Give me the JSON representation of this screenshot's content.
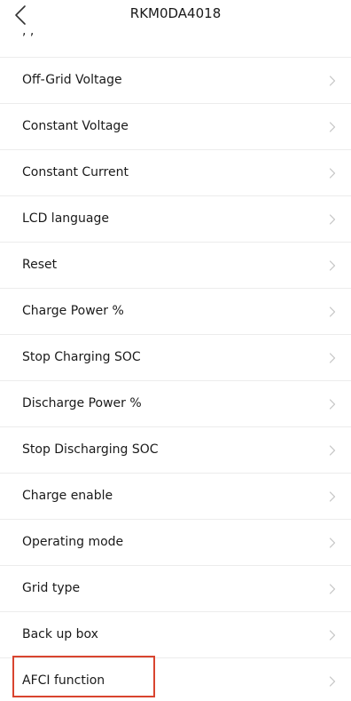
{
  "header": {
    "title": "RKM0DA4018",
    "back_icon": "chevron-left-icon"
  },
  "partial_row_text": ", ,",
  "settings": [
    {
      "label": "Off-Grid Voltage"
    },
    {
      "label": "Constant Voltage"
    },
    {
      "label": "Constant Current"
    },
    {
      "label": "LCD language"
    },
    {
      "label": "Reset"
    },
    {
      "label": "Charge Power %"
    },
    {
      "label": "Stop Charging SOC"
    },
    {
      "label": "Discharge Power %"
    },
    {
      "label": "Stop Discharging SOC"
    },
    {
      "label": "Charge enable"
    },
    {
      "label": "Operating mode"
    },
    {
      "label": "Grid type"
    },
    {
      "label": "Back up box"
    },
    {
      "label": "AFCI function"
    }
  ],
  "row_icon": "chevron-right-icon",
  "highlight": {
    "target": "AFCI function",
    "color": "#d9442f"
  }
}
